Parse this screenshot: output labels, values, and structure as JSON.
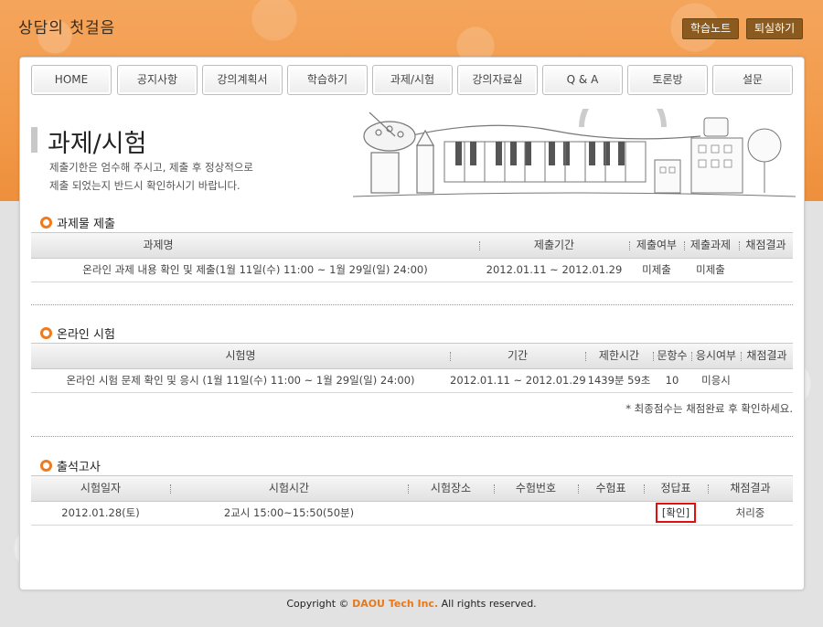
{
  "site": {
    "title": "상담의 첫걸음"
  },
  "top_buttons": {
    "notes": "학습노트",
    "logout": "퇴실하기"
  },
  "nav": [
    {
      "label": "HOME"
    },
    {
      "label": "공지사항"
    },
    {
      "label": "강의계획서"
    },
    {
      "label": "학습하기"
    },
    {
      "label": "과제/시험"
    },
    {
      "label": "강의자료실"
    },
    {
      "label": "Q & A"
    },
    {
      "label": "토론방"
    },
    {
      "label": "설문"
    }
  ],
  "page": {
    "title": "과제/시험",
    "desc_line1": "제출기한은 엄수해 주시고, 제출 후 정상적으로",
    "desc_line2": "제출 되었는지 반드시 확인하시기 바랍니다."
  },
  "assignment": {
    "section_title": "과제물 제출",
    "headers": [
      "과제명",
      "제출기간",
      "제출여부",
      "제출과제",
      "채점결과"
    ],
    "rows": [
      {
        "name": "온라인 과제 내용 확인 및 제출(1월 11일(수) 11:00 ~ 1월 29일(일) 24:00)",
        "period": "2012.01.11 ~ 2012.01.29",
        "submitted": "미제출",
        "file": "미제출",
        "result": ""
      }
    ]
  },
  "exam": {
    "section_title": "온라인 시험",
    "headers": [
      "시험명",
      "기간",
      "제한시간",
      "문항수",
      "응시여부",
      "채점결과"
    ],
    "rows": [
      {
        "name": "온라인 시험 문제 확인 및 응시 (1월 11일(수) 11:00 ~ 1월 29일(일) 24:00)",
        "period": "2012.01.11 ~ 2012.01.29",
        "limit": "1439분 59초",
        "count": "10",
        "taken": "미응시",
        "result": ""
      }
    ],
    "note": "* 최종점수는 채점완료 후 확인하세요."
  },
  "attendance": {
    "section_title": "출석고사",
    "headers": [
      "시험일자",
      "시험시간",
      "시험장소",
      "수험번호",
      "수험표",
      "정답표",
      "채점결과"
    ],
    "rows": [
      {
        "date": "2012.01.28(토)",
        "time": "2교시 15:00~15:50(50분)",
        "place": "",
        "number": "",
        "ticket": "",
        "answer": "[확인]",
        "result": "처리중"
      }
    ]
  },
  "footer": {
    "prefix": "Copyright ©",
    "brand": "DAOU Tech Inc.",
    "suffix": "All rights reserved."
  },
  "colors": {
    "accent": "#ef7b1e",
    "highlight_border": "#e01010",
    "top_button": "#8a5a1e"
  }
}
